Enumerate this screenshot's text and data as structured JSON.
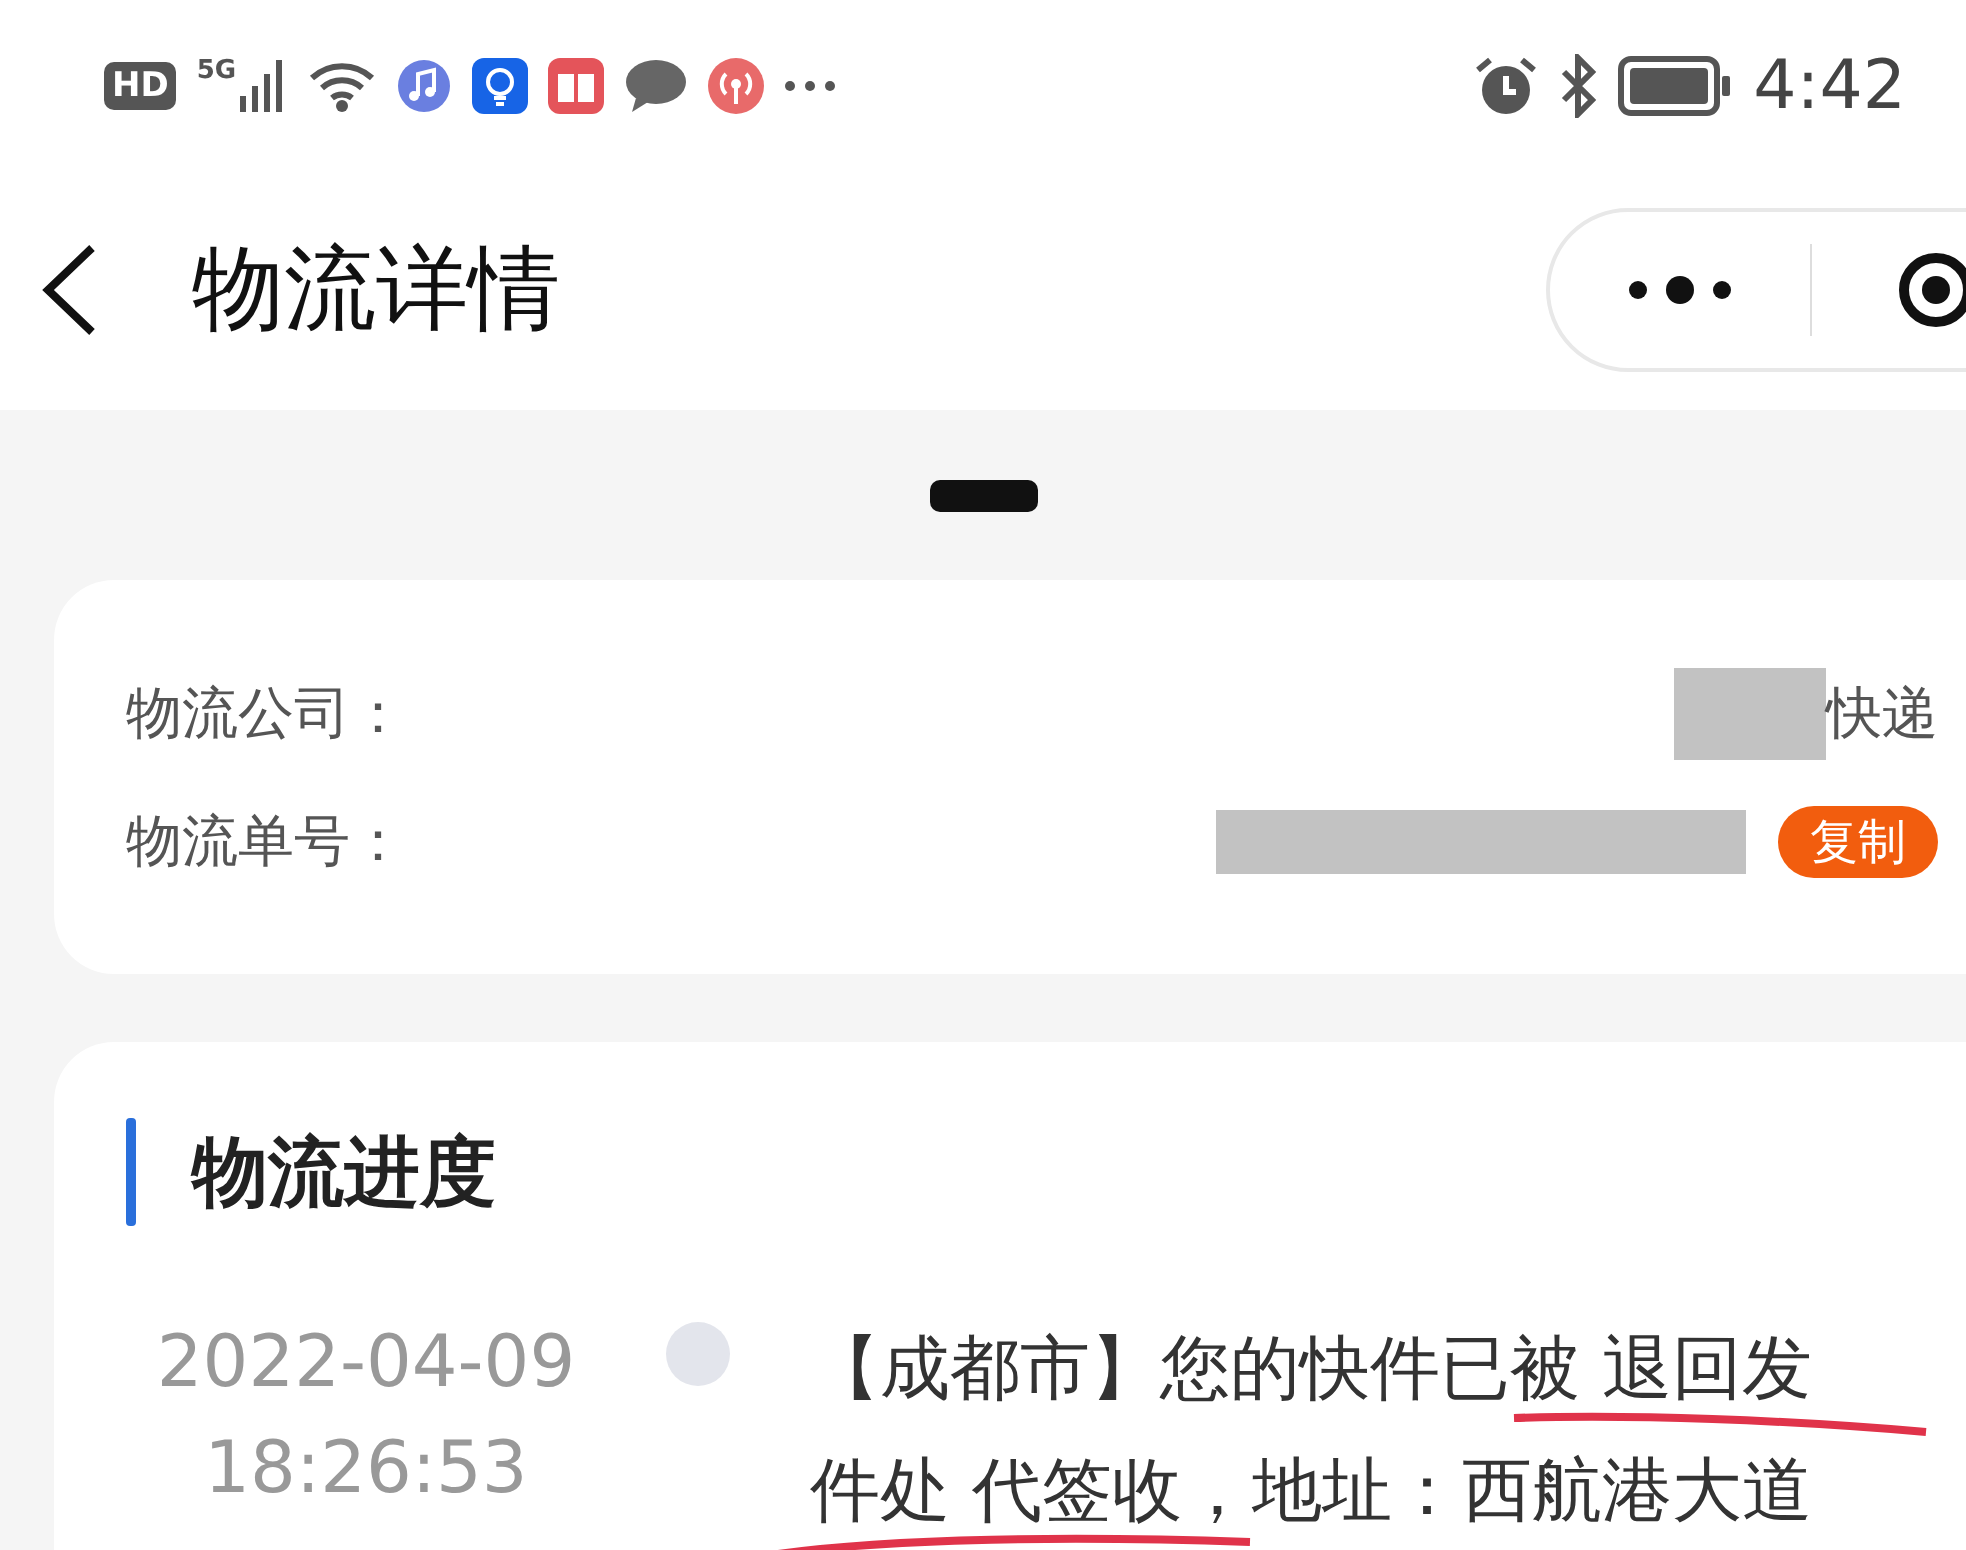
{
  "status_bar": {
    "hd": "HD",
    "network": "5G",
    "time": "4:42"
  },
  "nav": {
    "title": "物流详情"
  },
  "info": {
    "rows": [
      {
        "label": "物流公司：",
        "value": "快递",
        "kind": "company"
      },
      {
        "label": "物流单号：",
        "button": "复制",
        "kind": "tracking"
      }
    ]
  },
  "progress": {
    "title": "物流进度",
    "events": [
      {
        "date": "2022-04-09",
        "time": "18:26:53",
        "lines": [
          "【成都市】您的快件已被 退回发",
          "件处 代签收，地址：西航港大道"
        ]
      }
    ]
  }
}
